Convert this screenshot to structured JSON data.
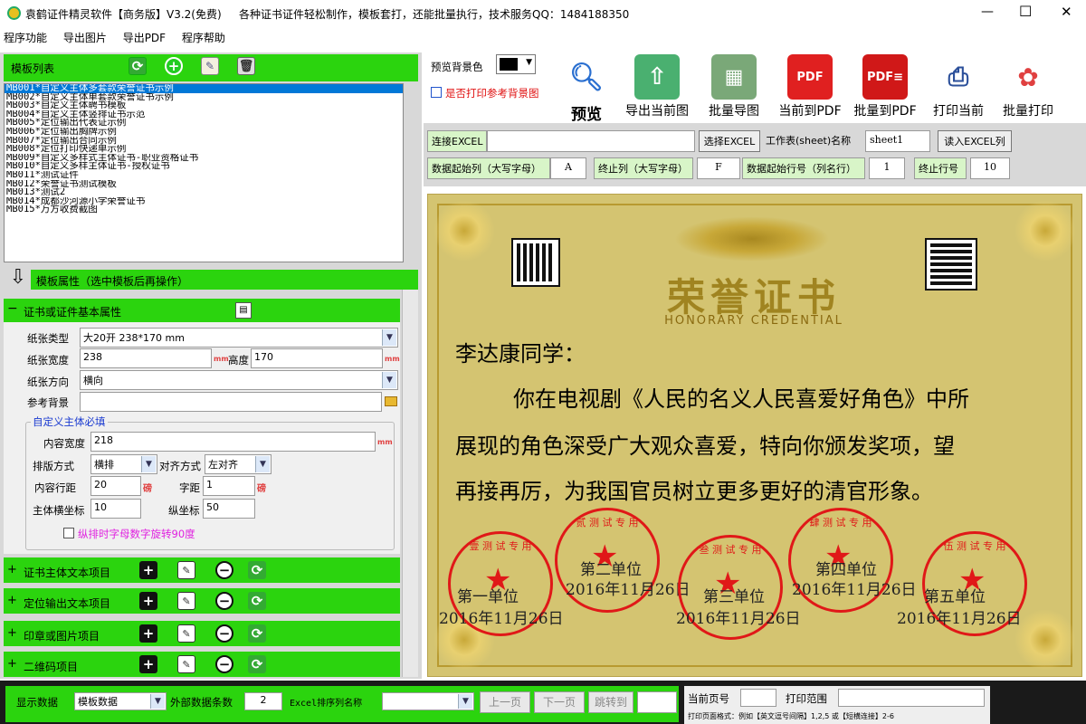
{
  "titlebar": {
    "title": "袁鹤证件精灵软件【商务版】V3.2(免费)",
    "tagline": "各种证书证件轻松制作，模板套打，还能批量执行，技术服务QQ：1484188350",
    "minimize": "—",
    "maximize": "☐",
    "close": "✕"
  },
  "menu": [
    "程序功能",
    "导出图片",
    "导出PDF",
    "程序帮助"
  ],
  "template_panel": {
    "header": "模板列表",
    "items": [
      "MB001*自定义主体多套款荣誉证书示例",
      "MB002*自定义主体单套款荣誉证书示例",
      "MB003*自定义主体聘书模板",
      "MB004*自定义主体竖排证书示范",
      "MB005*定位输出代表证示例",
      "MB006*定位输出胸牌示例",
      "MB007*定位输出合同示例",
      "MB008*定位打印快递单示例",
      "MB009*自定义多样式主体证书-职业资格证书",
      "MB010*自定义多样主体证书-授权证书",
      "MB011*测试证件",
      "MB012*荣誉证书测试模板",
      "MB013*测试2",
      "MB014*成都沙河源小学荣誉证书",
      "MB015*万方收费截图"
    ],
    "selected_index": 0
  },
  "props_panel": {
    "header": "模板属性（选中模板后再操作）",
    "basic_header": "证书或证件基本属性",
    "paper_type_label": "纸张类型",
    "paper_type_value": "大20开 238*170 mm",
    "width_label": "纸张宽度",
    "width_value": "238",
    "height_label": "高度",
    "height_value": "170",
    "unit_mm": "mm",
    "orientation_label": "纸张方向",
    "orientation_value": "横向",
    "ref_bg_label": "参考背景",
    "ref_bg_value": "",
    "custom_group": "自定义主体必填",
    "content_width_label": "内容宽度",
    "content_width_value": "218",
    "layout_label": "排版方式",
    "layout_value": "横排",
    "align_label": "对齐方式",
    "align_value": "左对齐",
    "line_spacing_label": "内容行距",
    "line_spacing_value": "20",
    "char_spacing_label": "字距",
    "char_spacing_value": "1",
    "unit_pound": "磅",
    "x_label": "主体横坐标",
    "x_value": "10",
    "y_label": "纵坐标",
    "y_value": "50",
    "rotate_label": "纵排时字母数字旋转90度"
  },
  "sections": [
    "证书主体文本项目",
    "定位输出文本项目",
    "印章或图片项目",
    "二维码项目"
  ],
  "toolbar": {
    "bg_color_label": "预览背景色",
    "print_ref_label": "是否打印参考背景图",
    "preview": "预览",
    "export_current": "导出当前图",
    "batch_export": "批量导图",
    "current_pdf": "当前到PDF",
    "batch_pdf": "批量到PDF",
    "print_current": "打印当前",
    "batch_print": "批量打印"
  },
  "excel": {
    "connect_label": "连接EXCEL",
    "connect_value": "",
    "select_btn": "选择EXCEL",
    "sheet_label": "工作表(sheet)名称",
    "sheet_value": "sheet1",
    "read_btn": "读入EXCEL列",
    "start_col_label": "数据起始列（大写字母）",
    "start_col_value": "A",
    "end_col_label": "终止列（大写字母）",
    "end_col_value": "F",
    "start_row_label": "数据起始行号（列名行）",
    "start_row_value": "1",
    "end_row_label": "终止行号",
    "end_row_value": "10"
  },
  "certificate": {
    "title_cn": "荣誉证书",
    "title_en": "HONORARY CREDENTIAL",
    "greeting": "李达康同学：",
    "line1": "你在电视剧《人民的名义人民喜爱好角色》中所",
    "line2": "展现的角色深受广大观众喜爱，特向你颁发奖项，望",
    "line3": "再接再厉，为我国官员树立更多更好的清官形象。",
    "stamps": [
      {
        "ring": "壹 测 试 专 用",
        "unit": "第一单位",
        "date": "2016年11月26日"
      },
      {
        "ring": "贰 测 试 专 用",
        "unit": "第二单位",
        "date": "2016年11月26日"
      },
      {
        "ring": "叁 测 试 专 用",
        "unit": "第三单位",
        "date": "2016年11月26日"
      },
      {
        "ring": "肆 测 试 专 用",
        "unit": "第四单位",
        "date": "2016年11月26日"
      },
      {
        "ring": "伍 测 试 专 用",
        "unit": "第五单位",
        "date": "2016年11月26日"
      }
    ]
  },
  "bottombar": {
    "display_label": "显示数据",
    "display_value": "模板数据",
    "ext_count_label": "外部数据条数",
    "ext_count_value": "2",
    "sort_label": "Excel排序列名称",
    "sort_value": "",
    "prev": "上一页",
    "next": "下一页",
    "jump": "跳转到",
    "jump_value": "",
    "current_page_label": "当前页号",
    "current_page_value": "",
    "print_range_label": "打印范围",
    "print_range_value": "",
    "range_hint": "打印页面格式：例如【英文逗号间隔】1,2,5 或【短横连接】2-6"
  },
  "colors": {
    "green": "#2bd40e",
    "cert_bg": "#d4c471",
    "stamp_red": "#e01818",
    "title_gold": "#a08420"
  }
}
